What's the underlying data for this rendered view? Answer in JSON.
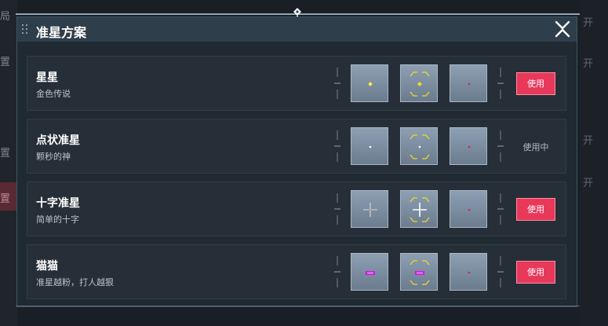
{
  "background": {
    "left_labels": [
      "局",
      "置",
      "置",
      "置"
    ],
    "right_labels": [
      "开",
      "开",
      "开",
      "开"
    ]
  },
  "dialog": {
    "title": "准星方案",
    "close_icon": "close-icon",
    "accent_color": "#e8395b",
    "rows": [
      {
        "name": "星星",
        "desc": "金色传说",
        "action": "使用",
        "in_use": false
      },
      {
        "name": "点状准星",
        "desc": "颗秒的神",
        "action": "使用中",
        "in_use": true
      },
      {
        "name": "十字准星",
        "desc": "简单的十字",
        "action": "使用",
        "in_use": false
      },
      {
        "name": "猫猫",
        "desc": "准星越粉，打人越狠",
        "action": "使用",
        "in_use": false
      }
    ]
  }
}
